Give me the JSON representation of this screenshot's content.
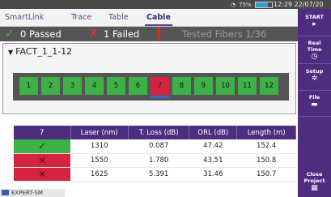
{
  "status_bar": {
    "battery": "75%",
    "clock": "12:29 22/07/20"
  },
  "tabs": [
    {
      "label": "SmartLink",
      "active": false
    },
    {
      "label": "Trace",
      "active": false
    },
    {
      "label": "Table",
      "active": false
    },
    {
      "label": "Cable",
      "active": true
    }
  ],
  "summary": {
    "passed": "0 Passed",
    "failed": "1 Failed",
    "tested": "Tested Fibers 1/36"
  },
  "cable": {
    "name": "FACT_1_1-12",
    "fibers": [
      {
        "label": "1",
        "status": "pass"
      },
      {
        "label": "2",
        "status": "pass"
      },
      {
        "label": "3",
        "status": "pass"
      },
      {
        "label": "4",
        "status": "pass"
      },
      {
        "label": "5",
        "status": "pass"
      },
      {
        "label": "6",
        "status": "pass"
      },
      {
        "label": "7",
        "status": "fail",
        "selected": true
      },
      {
        "label": "8",
        "status": "pass"
      },
      {
        "label": "9",
        "status": "pass"
      },
      {
        "label": "10",
        "status": "pass"
      },
      {
        "label": "11",
        "status": "pass"
      },
      {
        "label": "12",
        "status": "pass"
      }
    ]
  },
  "results": {
    "headers": [
      "7",
      "Laser (nm)",
      "T. Loss (dB)",
      "ORL (dB)",
      "Length (m)"
    ],
    "rows": [
      {
        "status": "pass",
        "icon": "✓",
        "laser": "1310",
        "tloss": "0.087",
        "orl": "47.42",
        "length": "152.4"
      },
      {
        "status": "fail",
        "icon": "✕",
        "laser": "1550",
        "tloss": "1.780",
        "orl": "43.51",
        "length": "150.8"
      },
      {
        "status": "fail",
        "icon": "✕",
        "laser": "1625",
        "tloss": "5.391",
        "orl": "31.46",
        "length": "150.7"
      }
    ]
  },
  "footer": {
    "label": "EXPERT-SM"
  },
  "sidebar": {
    "start": {
      "label": "START",
      "glyph": "▸"
    },
    "realtime": {
      "label1": "Real",
      "label2": "Time",
      "glyph": "◷"
    },
    "setup": {
      "label": "Setup",
      "glyph": "✲"
    },
    "file": {
      "label": "File",
      "glyph": "▬"
    },
    "close": {
      "label1": "Close",
      "label2": "Project",
      "glyph": "▦"
    }
  },
  "colors": {
    "accent": "#4d2d80",
    "pass": "#3eb048",
    "fail": "#d6233f"
  }
}
